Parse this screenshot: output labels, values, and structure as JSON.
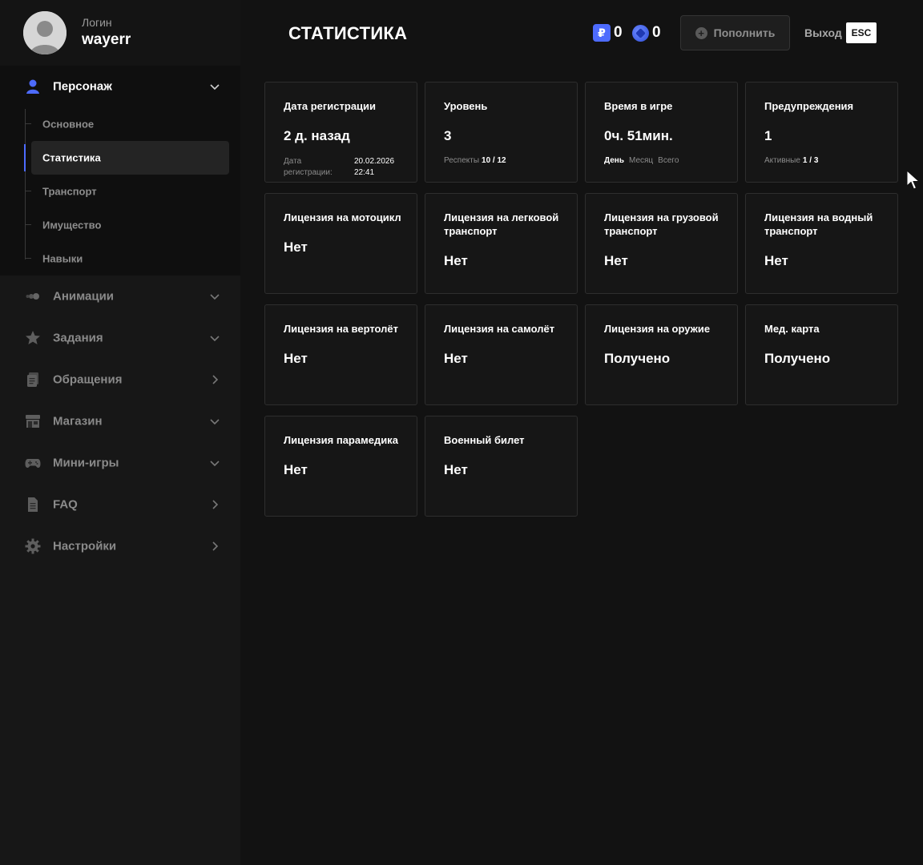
{
  "profile": {
    "login_label": "Логин",
    "login_value": "wayerr"
  },
  "nav": [
    {
      "id": "persona",
      "label": "Персонаж",
      "icon": "user-icon",
      "expanded": true,
      "active": true
    },
    {
      "id": "animations",
      "label": "Анимации",
      "icon": "animation-icon",
      "expanded": false
    },
    {
      "id": "tasks",
      "label": "Задания",
      "icon": "star-icon",
      "expanded": false
    },
    {
      "id": "tickets",
      "label": "Обращения",
      "icon": "tickets-icon",
      "expanded": false
    },
    {
      "id": "shop",
      "label": "Магазин",
      "icon": "store-icon",
      "expanded": false
    },
    {
      "id": "minigames",
      "label": "Мини-игры",
      "icon": "gamepad-icon",
      "expanded": false
    },
    {
      "id": "faq",
      "label": "FAQ",
      "icon": "document-icon",
      "expanded": false
    },
    {
      "id": "settings",
      "label": "Настройки",
      "icon": "gear-icon",
      "expanded": false
    }
  ],
  "subnav": [
    {
      "label": "Основное",
      "active": false
    },
    {
      "label": "Статистика",
      "active": true
    },
    {
      "label": "Транспорт",
      "active": false
    },
    {
      "label": "Имущество",
      "active": false
    },
    {
      "label": "Навыки",
      "active": false
    }
  ],
  "header": {
    "title": "СТАТИСТИКА",
    "currency_symbol": "₽",
    "rub_balance": "0",
    "coin_balance": "0",
    "topup_label": "Пополнить",
    "exit_label": "Выход",
    "esc_key": "ESC"
  },
  "stats": {
    "registration": {
      "title": "Дата регистрации",
      "value": "2 д. назад",
      "date_label": "Дата регистрации:",
      "date_value": "20.02.2026",
      "time_value": "22:41"
    },
    "level": {
      "title": "Уровень",
      "value": "3",
      "respect_label": "Респекты",
      "respect_value": "10 / 12"
    },
    "playtime": {
      "title": "Время в игре",
      "value": "0ч. 51мин.",
      "periods": [
        "День",
        "Месяц",
        "Всего"
      ],
      "selected_period": "День"
    },
    "warnings": {
      "title": "Предупреждения",
      "value": "1",
      "active_label": "Активные",
      "active_value": "1 / 3"
    }
  },
  "licenses": [
    {
      "title": "Лицензия на мотоцикл",
      "value": "Нет"
    },
    {
      "title": "Лицензия на легковой транспорт",
      "value": "Нет"
    },
    {
      "title": "Лицензия на грузовой транспорт",
      "value": "Нет"
    },
    {
      "title": "Лицензия на водный транспорт",
      "value": "Нет"
    },
    {
      "title": "Лицензия на вертолёт",
      "value": "Нет"
    },
    {
      "title": "Лицензия на самолёт",
      "value": "Нет"
    },
    {
      "title": "Лицензия на оружие",
      "value": "Получено"
    },
    {
      "title": "Мед. карта",
      "value": "Получено"
    },
    {
      "title": "Лицензия парамедика",
      "value": "Нет"
    },
    {
      "title": "Военный билет",
      "value": "Нет"
    }
  ],
  "colors": {
    "accent": "#4d6bfe",
    "background": "#121212",
    "sidebar": "#171717",
    "card": "#161616"
  }
}
